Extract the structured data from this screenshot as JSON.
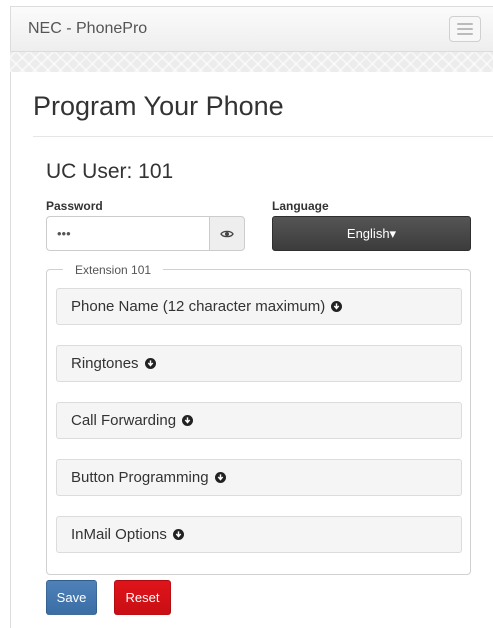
{
  "navbar": {
    "brand": "NEC - PhonePro"
  },
  "page": {
    "title": "Program Your Phone"
  },
  "user": {
    "heading": "UC User: 101"
  },
  "password": {
    "label": "Password",
    "value": "•••"
  },
  "language": {
    "label": "Language",
    "value": "English▾"
  },
  "extension": {
    "legend": "Extension 101",
    "sections": [
      {
        "label": "Phone Name (12 character maximum)"
      },
      {
        "label": "Ringtones"
      },
      {
        "label": "Call Forwarding"
      },
      {
        "label": "Button Programming"
      },
      {
        "label": "InMail Options"
      }
    ]
  },
  "actions": {
    "save": "Save",
    "reset": "Reset"
  },
  "colors": {
    "save": "#3a6ea5",
    "reset": "#d0101a",
    "language_button": "#444444"
  },
  "icons": {
    "toggle": "hamburger-icon",
    "password_toggle": "eye-icon",
    "section_expand": "circle-arrow-down-icon"
  }
}
